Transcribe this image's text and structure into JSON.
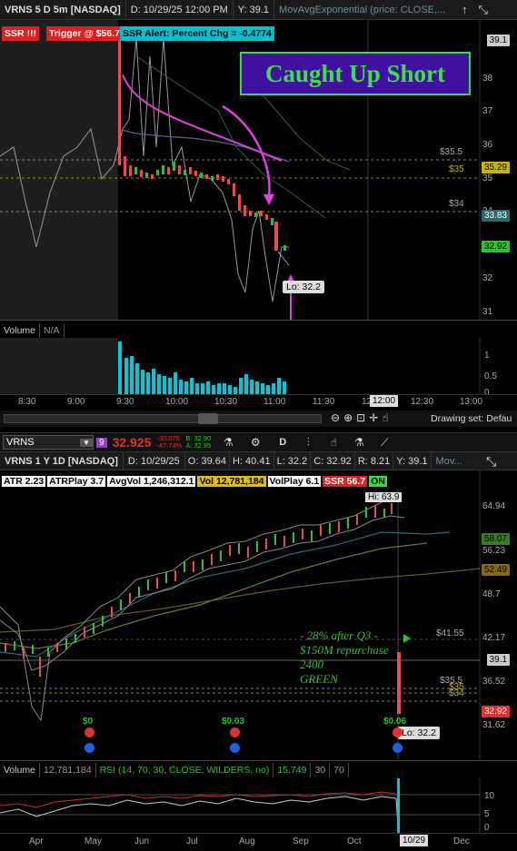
{
  "top_chart": {
    "header": {
      "symbol": "VRNS 5 D 5m [NASDAQ]",
      "datetime": "D: 10/29/25 12:00 PM",
      "y_value": "Y: 39.1",
      "study": "MovAvgExponential (price: CLOSE,..."
    },
    "tags": {
      "ssr": "SSR !!!",
      "trigger": "Trigger @ $56.70",
      "alert": "SSR Alert: Percent Chg = -0.4774"
    },
    "annotation": "Caught Up  Short",
    "low_label": "Lo: 32.2",
    "price_levels": {
      "l1": "$35.5",
      "l2": "$35",
      "l3": "$34"
    },
    "price_boxes": {
      "top": "39.1",
      "mid": "35.29",
      "low": "33.83",
      "last": "32.92"
    },
    "y_ticks": [
      "38",
      "37",
      "36",
      "35",
      "34",
      "33",
      "32",
      "31"
    ],
    "volume_label": "Volume",
    "volume_value": "N/A",
    "volume_ticks": [
      "1",
      "0.5",
      "0"
    ],
    "x_ticks": [
      "8:30",
      "9:00",
      "9:30",
      "10:00",
      "10:30",
      "11:00",
      "11:30",
      "12:00",
      "12:30",
      "13:00"
    ],
    "x_highlight": "12:00",
    "drawing_set": "Drawing set: Defau"
  },
  "toolbar": {
    "symbol": "VRNS",
    "badge": "9",
    "price": "32.925",
    "change": "-30.075",
    "change_pct": "-47.74%",
    "bid": "B: 32.90",
    "ask": "A: 32.95",
    "period": "D"
  },
  "bottom_chart": {
    "header": {
      "symbol": "VRNS 1 Y 1D [NASDAQ]",
      "date": "D: 10/29/25",
      "open": "O: 39.64",
      "high": "H: 40.41",
      "low": "L: 32.2",
      "close": "C: 32.92",
      "range": "R: 8.21",
      "y": "Y: 39.1",
      "study": "Mov..."
    },
    "studies": {
      "atr": "ATR 2.23",
      "atrplay": "ATRPlay 3.7",
      "avgvol": "AvgVol 1,246,312.1",
      "vol": "Vol 12,781,184",
      "volplay": "VolPlay 6.1",
      "ssr": "SSR 56.7",
      "on": "ON"
    },
    "hi_label": "Hi: 63.9",
    "lo_label": "Lo: 32.2",
    "note_lines": [
      "- 28% after Q3 -",
      "$150M repurchase",
      "2400",
      "GREEN"
    ],
    "price_levels": {
      "l1": "$41.55",
      "l2": "$35.5",
      "l3": "$35",
      "l4": "$34"
    },
    "y_ticks": [
      "64.94",
      "56.23",
      "48.7",
      "42.17",
      "36.52",
      "31.62"
    ],
    "price_boxes": {
      "b1": "58.07",
      "b2": "52.49",
      "b3": "39.1",
      "b4": "32.92"
    },
    "dividends": [
      "$0",
      "$0.03",
      "$0.06"
    ],
    "volume_label": "Volume",
    "volume_value": "12,781,184",
    "rsi_label": "RSI (14, 70, 30, CLOSE, WILDERS, no)",
    "rsi_value": "15.749",
    "rsi_high": "30",
    "rsi_low": "70",
    "rsi_ticks": [
      "10",
      "5",
      "0"
    ],
    "x_ticks": [
      "Apr",
      "May",
      "Jun",
      "Jul",
      "Aug",
      "Sep",
      "Oct",
      "Dec"
    ],
    "x_highlight": "10/29"
  }
}
